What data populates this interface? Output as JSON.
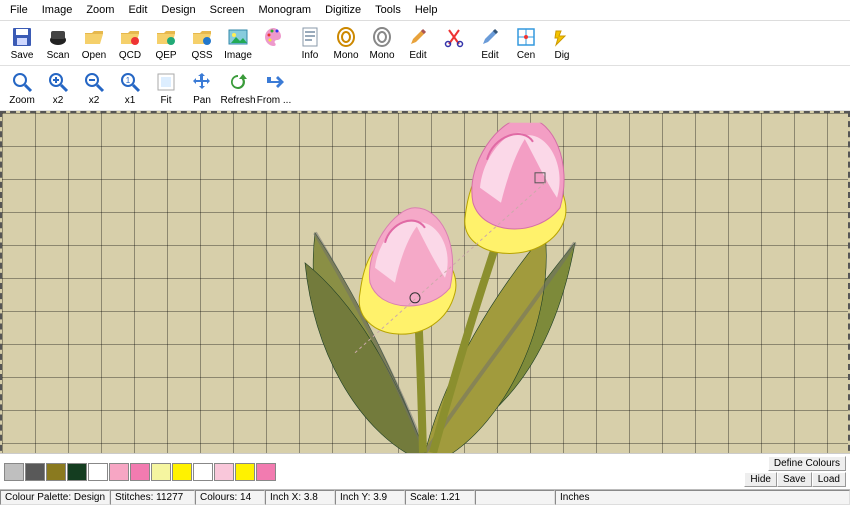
{
  "menu": [
    "File",
    "Image",
    "Zoom",
    "Edit",
    "Design",
    "Screen",
    "Monogram",
    "Digitize",
    "Tools",
    "Help"
  ],
  "tool1": [
    {
      "n": "save-button",
      "l": "Save"
    },
    {
      "n": "scan-button",
      "l": "Scan"
    },
    {
      "n": "open-button",
      "l": "Open"
    },
    {
      "n": "qcd-button",
      "l": "QCD"
    },
    {
      "n": "qep-button",
      "l": "QEP"
    },
    {
      "n": "qss-button",
      "l": "QSS"
    },
    {
      "n": "image-button",
      "l": "Image"
    },
    {
      "n": "palette-button",
      "l": ""
    },
    {
      "n": "info-button",
      "l": "Info"
    },
    {
      "n": "mono-button",
      "l": "Mono"
    },
    {
      "n": "mono2-button",
      "l": "Mono"
    },
    {
      "n": "edit-button",
      "l": "Edit"
    },
    {
      "n": "cut-button",
      "l": ""
    },
    {
      "n": "edit2-button",
      "l": "Edit"
    },
    {
      "n": "center-button",
      "l": "Cen"
    },
    {
      "n": "dig-button",
      "l": "Dig"
    }
  ],
  "tool2": [
    {
      "n": "zoom-button",
      "l": "Zoom"
    },
    {
      "n": "zoom-in-button",
      "l": "x2"
    },
    {
      "n": "zoom-out-button",
      "l": "x2"
    },
    {
      "n": "zoom-1x-button",
      "l": "x1"
    },
    {
      "n": "fit-button",
      "l": "Fit"
    },
    {
      "n": "pan-button",
      "l": "Pan"
    },
    {
      "n": "refresh-button",
      "l": "Refresh"
    },
    {
      "n": "from-button",
      "l": "From ..."
    }
  ],
  "palette_colors": [
    "#bfbfbf",
    "#595959",
    "#8a7a1f",
    "#143d20",
    "#ffffff",
    "#f7a6c4",
    "#f27bb0",
    "#f5f5a0",
    "#fff200",
    "#ffffff",
    "#f9c7da",
    "#fff200",
    "#f27bb0"
  ],
  "define_colours": "Define Colours",
  "btns": {
    "hide": "Hide",
    "save": "Save",
    "load": "Load"
  },
  "status": {
    "palette_label": "Colour Palette: Design",
    "stitches_label": "Stitches:",
    "stitches": "11277",
    "colours_label": "Colours:",
    "colours": "14",
    "inchx_label": "Inch X:",
    "inchx": "3.8",
    "inchy_label": "Inch Y:",
    "inchy": "3.9",
    "scale_label": "Scale:",
    "scale": "1.21",
    "units": "Inches"
  }
}
